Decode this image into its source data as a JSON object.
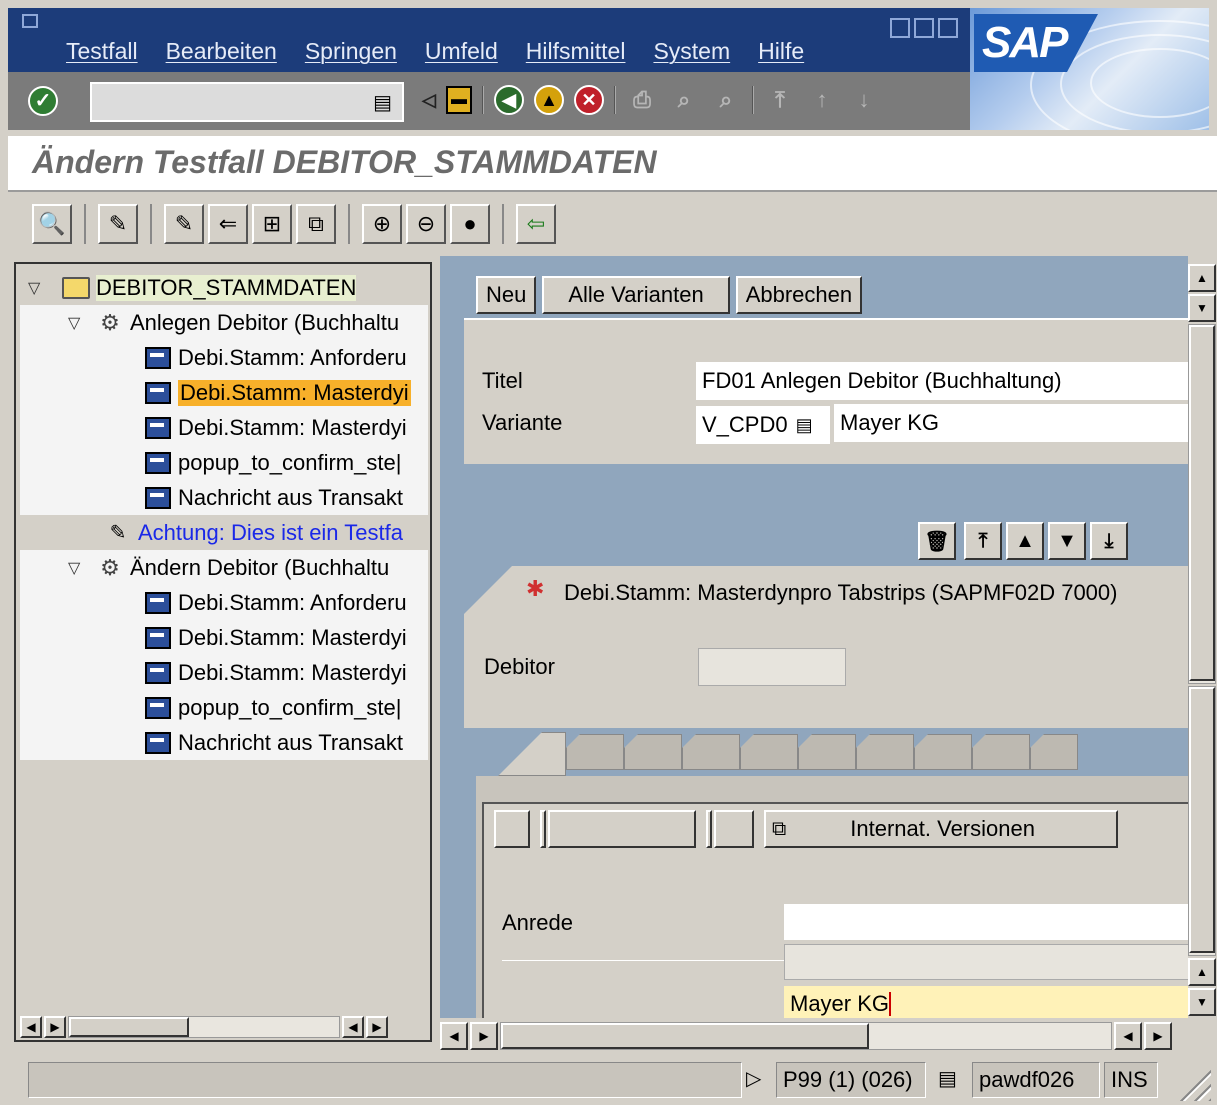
{
  "menubar": {
    "items": [
      "Testfall",
      "Bearbeiten",
      "Springen",
      "Umfeld",
      "Hilfsmittel",
      "System",
      "Hilfe"
    ],
    "logo": "SAP"
  },
  "system_toolbar": {
    "command_value": "",
    "icons": [
      "enter-icon",
      "save-icon",
      "back-icon",
      "exit-icon",
      "cancel-icon",
      "print-icon",
      "find-icon",
      "find-next-icon",
      "first-page-icon",
      "previous-page-icon",
      "next-page-icon"
    ]
  },
  "title": "Ändern Testfall DEBITOR_STAMMDATEN",
  "tree": {
    "root": "DEBITOR_STAMMDATEN",
    "node1": "Anlegen Debitor (Buchhaltu",
    "node1_children": [
      "Debi.Stamm: Anforderu",
      "Debi.Stamm: Masterdyi",
      "Debi.Stamm: Masterdyi",
      "popup_to_confirm_ste|",
      "Nachricht aus Transakt"
    ],
    "warning": "Achtung: Dies ist ein Testfa",
    "node2": "Ändern Debitor (Buchhaltu",
    "node2_children": [
      "Debi.Stamm: Anforderu",
      "Debi.Stamm: Masterdyi",
      "Debi.Stamm: Masterdyi",
      "popup_to_confirm_ste|",
      "Nachricht aus Transakt"
    ]
  },
  "detail": {
    "buttons": {
      "neu": "Neu",
      "alle_varianten": "Alle Varianten",
      "abbrechen": "Abbrechen"
    },
    "titel_label": "Titel",
    "titel_value": "FD01 Anlegen Debitor (Buchhaltung)",
    "variante_label": "Variante",
    "variante_value": "V_CPD0",
    "variante_text": "Mayer KG",
    "screen_title": "Debi.Stamm: Masterdynpro Tabstrips (SAPMF02D 7000)",
    "debitor_label": "Debitor",
    "debitor_value": "",
    "internat_button": "Internat. Versionen",
    "anrede_label": "Anrede",
    "anrede_value": "",
    "name_value": "Mayer KG"
  },
  "statusbar": {
    "system": "P99 (1) (026)",
    "server": "pawdf026",
    "mode": "INS"
  }
}
